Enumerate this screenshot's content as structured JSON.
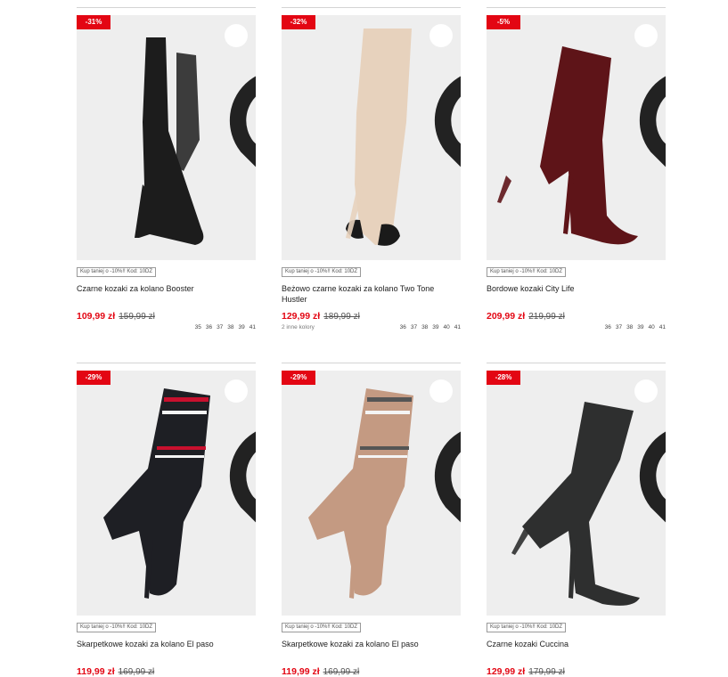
{
  "products": [
    {
      "discount": "-31%",
      "promo": "Kup taniej o -10%!! Kod: 10DZ",
      "name": "Czarne kozaki za kolano Booster",
      "price": "109,99 zł",
      "old_price": "159,99 zł",
      "colors_note": "",
      "sizes": [
        "35",
        "36",
        "37",
        "38",
        "39",
        "41"
      ],
      "boot_color": "#1c1c1c",
      "photo_bg": "#eeeeee"
    },
    {
      "discount": "-32%",
      "promo": "Kup taniej o -10%!! Kod: 10DZ",
      "name": "Beżowo czarne kozaki za kolano Two Tone Hustler",
      "price": "129,99 zł",
      "old_price": "189,99 zł",
      "colors_note": "2 inne kolory",
      "sizes": [
        "36",
        "37",
        "38",
        "39",
        "40",
        "41"
      ],
      "boot_color": "#e7d2bd",
      "photo_bg": "#eeeeee"
    },
    {
      "discount": "-5%",
      "promo": "Kup taniej o -10%!! Kod: 10DZ",
      "name": "Bordowe kozaki City Life",
      "price": "209,99 zł",
      "old_price": "219,99 zł",
      "colors_note": "",
      "sizes": [
        "36",
        "37",
        "38",
        "39",
        "40",
        "41"
      ],
      "boot_color": "#5e1418",
      "photo_bg": "#eeeeee"
    },
    {
      "discount": "-29%",
      "promo": "Kup taniej o -10%!! Kod: 10DZ",
      "name": "Skarpetkowe kozaki za kolano El paso",
      "price": "119,99 zł",
      "old_price": "169,99 zł",
      "colors_note": "",
      "sizes": [],
      "boot_color": "#1e1f24",
      "photo_bg": "#eeeeee"
    },
    {
      "discount": "-29%",
      "promo": "Kup taniej o -10%!! Kod: 10DZ",
      "name": "Skarpetkowe kozaki za kolano El paso",
      "price": "119,99 zł",
      "old_price": "169,99 zł",
      "colors_note": "",
      "sizes": [],
      "boot_color": "#c49a82",
      "photo_bg": "#eeeeee"
    },
    {
      "discount": "-28%",
      "promo": "Kup taniej o -10%!! Kod: 10DZ",
      "name": "Czarne kozaki Cuccina",
      "price": "129,99 zł",
      "old_price": "179,99 zł",
      "colors_note": "",
      "sizes": [],
      "boot_color": "#2e2f2f",
      "photo_bg": "#eeeeee"
    }
  ],
  "icons": {
    "favorite": "heart-icon"
  },
  "colors": {
    "accent": "#e30613"
  }
}
